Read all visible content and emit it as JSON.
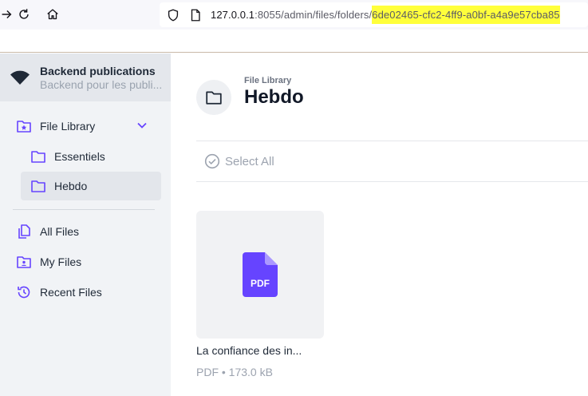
{
  "browser": {
    "url_host": "127.0.0.1",
    "url_rest": ":8055/admin/files/folders/",
    "url_highlight": "6de02465-cfc2-4ff9-a0bf-a4a9e57cba85",
    "highlight_color": "#ffff3b"
  },
  "app": {
    "title": "Backend publications",
    "subtitle": "Backend pour les publi..."
  },
  "sidebar": {
    "file_library": "File Library",
    "folders": [
      {
        "label": "Essentiels"
      },
      {
        "label": "Hebdo"
      }
    ],
    "all_files": "All Files",
    "my_files": "My Files",
    "recent_files": "Recent Files"
  },
  "main": {
    "breadcrumb": "File Library",
    "title": "Hebdo",
    "select_all": "Select All",
    "files": [
      {
        "icon": "pdf-icon",
        "icon_label": "PDF",
        "name": "La confiance des in...",
        "meta": "PDF • 173.0 kB"
      }
    ]
  },
  "colors": {
    "accent": "#6644ff",
    "sidebar_bg": "#f1f3f6",
    "header_bg": "#e4e7ec"
  }
}
